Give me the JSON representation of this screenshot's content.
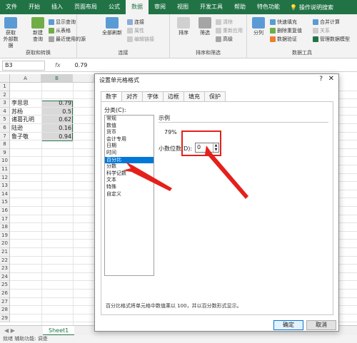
{
  "ribbon_tabs": [
    "文件",
    "开始",
    "插入",
    "页面布局",
    "公式",
    "数据",
    "审阅",
    "视图",
    "开发工具",
    "帮助",
    "特色功能"
  ],
  "ribbon_active_tab": "数据",
  "ribbon_search": "操作说明搜索",
  "groups": {
    "get_data": {
      "label": "获取和转换",
      "btn1": "获取\n外部数据",
      "btn2": "新建\n查询",
      "items": [
        "显示查询",
        "从表格",
        "最近使用的源"
      ]
    },
    "connections": {
      "label": "连接",
      "btn": "全部刷新",
      "items": [
        "连接",
        "属性",
        "编辑链接"
      ]
    },
    "sort_filter": {
      "label": "排序和筛选",
      "sort": "排序",
      "filter": "筛选",
      "items": [
        "清除",
        "重新应用",
        "高级"
      ]
    },
    "data_tools": {
      "label": "数据工具",
      "split": "分列",
      "items": [
        "快速填充",
        "删除重复值",
        "数据验证",
        "合并计算",
        "关系",
        "管理数据模型"
      ]
    }
  },
  "formula_bar": {
    "name_box": "B3",
    "fx": "fx",
    "value": "0.79"
  },
  "columns": [
    "A",
    "B"
  ],
  "rows": [
    "1",
    "2",
    "3",
    "4",
    "5",
    "6",
    "7",
    "8",
    "9",
    "10",
    "11",
    "12",
    "13",
    "14",
    "15",
    "16",
    "17",
    "18",
    "19",
    "20",
    "21",
    "22",
    "23",
    "24",
    "25",
    "26",
    "27",
    "28",
    "29"
  ],
  "cells": [
    {
      "name": "李思思",
      "value": "0.79"
    },
    {
      "name": "苏杨",
      "value": "0.5"
    },
    {
      "name": "诸葛孔明",
      "value": "0.62"
    },
    {
      "name": "陆逊",
      "value": "0.16"
    },
    {
      "name": "鲁子敬",
      "value": "0.94"
    }
  ],
  "sheet_tab": "Sheet1",
  "status": "就绪    辅助功能: 调查",
  "dialog": {
    "title": "设置单元格格式",
    "help": "?",
    "close": "✕",
    "tabs": [
      "数字",
      "对齐",
      "字体",
      "边框",
      "填充",
      "保护"
    ],
    "active_tab": "数字",
    "category_label": "分类(C):",
    "categories": [
      "常规",
      "数值",
      "货币",
      "会计专用",
      "日期",
      "时间",
      "百分比",
      "分数",
      "科学记数",
      "文本",
      "特殊",
      "自定义"
    ],
    "selected_category": "百分比",
    "sample_label": "示例",
    "sample_value": "79%",
    "decimals_label": "小数位数(D):",
    "decimals_value": "0",
    "description": "百分比格式将单元格中数值乘以 100，并以百分数形式显示。",
    "ok": "确定",
    "cancel": "取消"
  },
  "colors": {
    "excel_green": "#217346",
    "selection_blue": "#0078d7",
    "annotation_red": "#e5201b"
  }
}
